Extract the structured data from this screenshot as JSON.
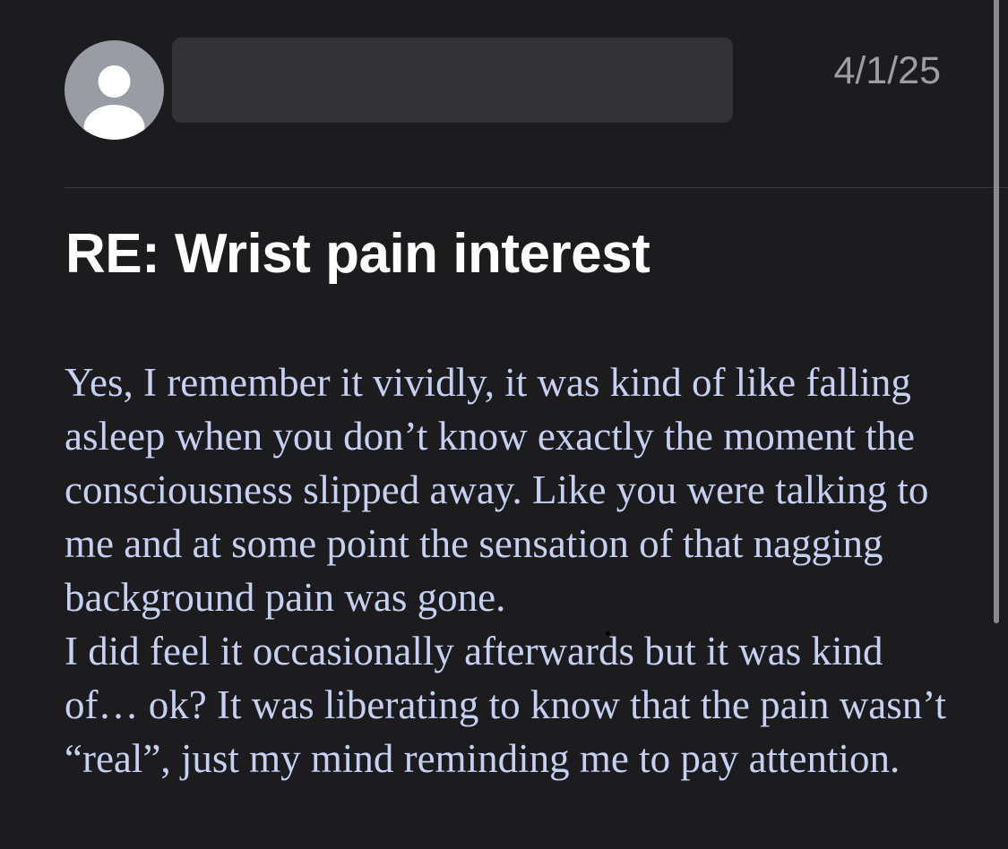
{
  "header": {
    "avatar_icon": "person-icon",
    "sender_name": "",
    "date": "4/1/25"
  },
  "message": {
    "subject": "RE: Wrist pain interest",
    "body_paragraphs": [
      "Yes, I remember it vividly, it was kind of like falling asleep when you don’t know exactly the moment the consciousness slipped away. Like you were talking to me and at some point the sensation of that nagging background pain was gone.",
      "I did feel it occasionally afterwards but it was kind of… ok? It was liberating to know that the pain wasn’t “real”, just my mind reminding me to pay attention."
    ]
  },
  "colors": {
    "background": "#1c1c1e",
    "body_text": "#c5d0f2",
    "subject_text": "#ffffff",
    "date_text": "#9d9da2"
  }
}
